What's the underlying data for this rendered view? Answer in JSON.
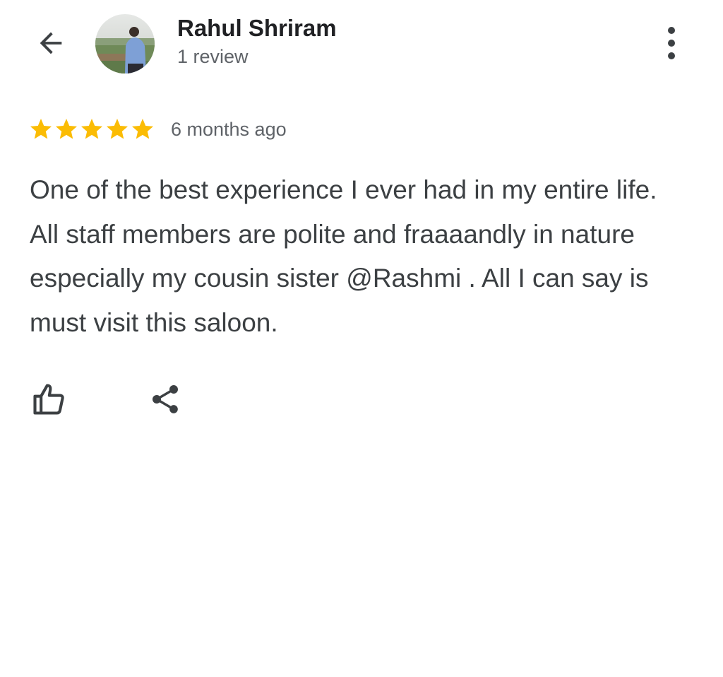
{
  "header": {
    "back_icon": "arrow-back-icon",
    "more_icon": "more-vertical-icon"
  },
  "reviewer": {
    "name": "Rahul Shriram",
    "review_count": "1 review",
    "avatar": "profile-photo"
  },
  "review": {
    "rating": 5,
    "max_rating": 5,
    "date": "6 months ago",
    "text": "One of the best experience I ever had in my entire life. All staff members are polite and fraaaandly in nature especially my cousin sister @Rashmi . All I can say is must visit this saloon."
  },
  "actions": {
    "like_icon": "thumb-up-icon",
    "share_icon": "share-icon"
  },
  "colors": {
    "star": "#fbbc04",
    "name": "#202124",
    "secondary": "#5f6368",
    "body_text": "#3c4043",
    "icon": "#3c4043"
  }
}
